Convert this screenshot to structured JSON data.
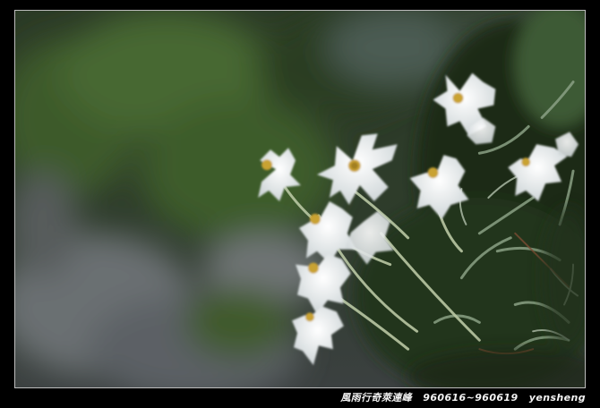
{
  "photo": {
    "subject": "edelweiss-flowers"
  },
  "caption": {
    "title": "風雨行奇萊連峰",
    "dates": "960616~960619",
    "author": "yensheng"
  },
  "colors": {
    "frame": "#000000",
    "border": "#bdbdbd",
    "petal": "#f4f6f7",
    "center": "#c9a233",
    "foliage_dark": "#1f3318",
    "foliage_mid": "#4e6e3a",
    "stone": "#7a7e82",
    "caption_text": "#f2f2f2"
  }
}
